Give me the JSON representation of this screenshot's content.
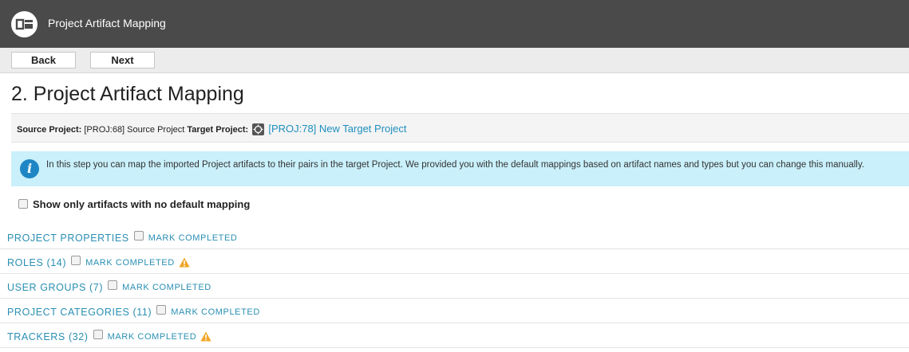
{
  "header": {
    "app_title": "Project Artifact Mapping",
    "logo_icon": "app-logo-icon"
  },
  "toolbar": {
    "back_label": "Back",
    "next_label": "Next"
  },
  "page": {
    "title": "2. Project Artifact Mapping"
  },
  "project_bar": {
    "source_label": "Source Project:",
    "source_value": "[PROJ:68] Source Project",
    "target_label": "Target Project:",
    "target_icon": "target-project-icon",
    "target_value": "[PROJ:78] New Target Project"
  },
  "info": {
    "icon": "info-icon",
    "text": "In this step you can map the imported Project artifacts to their pairs in the target Project. We provided you with the default mappings based on artifact names and types but you can change this manually."
  },
  "filter": {
    "label": "Show only artifacts with no default mapping",
    "checked": false
  },
  "sections": [
    {
      "label": "PROJECT PROPERTIES",
      "mark_label": "MARK COMPLETED",
      "warning": false
    },
    {
      "label": "ROLES (14)",
      "mark_label": "MARK COMPLETED",
      "warning": true
    },
    {
      "label": "USER GROUPS (7)",
      "mark_label": "MARK COMPLETED",
      "warning": false
    },
    {
      "label": "PROJECT CATEGORIES (11)",
      "mark_label": "MARK COMPLETED",
      "warning": false
    },
    {
      "label": "TRACKERS (32)",
      "mark_label": "MARK COMPLETED",
      "warning": true
    }
  ],
  "colors": {
    "header_bg": "#4a4a4a",
    "link": "#2a8fb3",
    "info_bg": "#c9f0fb",
    "info_icon": "#1f86c5",
    "warning": "#f0a526"
  }
}
